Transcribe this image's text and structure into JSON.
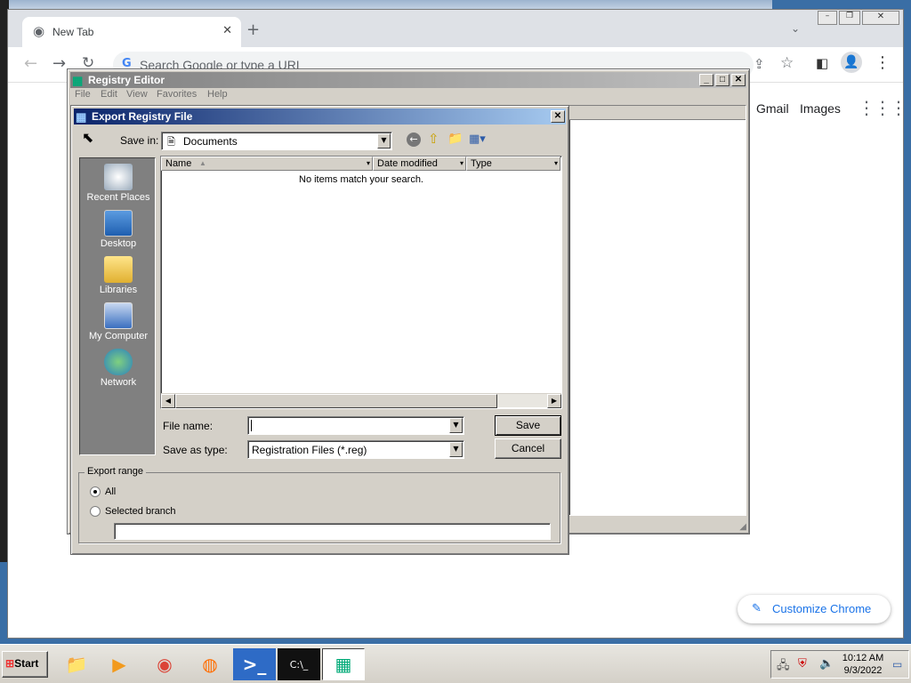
{
  "chrome": {
    "tab_title": "New Tab",
    "omnibox_placeholder": "Search Google or type a URL",
    "links": {
      "gmail": "Gmail",
      "images": "Images"
    },
    "customize_label": "Customize Chrome"
  },
  "regedit": {
    "title": "Registry Editor",
    "menu": [
      "File",
      "Edit",
      "View",
      "Favorites",
      "Help"
    ]
  },
  "dialog": {
    "title": "Export Registry File",
    "save_in_label": "Save in:",
    "save_in_value": "Documents",
    "places": [
      {
        "label": "Recent Places",
        "icon": "recent-places-icon"
      },
      {
        "label": "Desktop",
        "icon": "desktop-icon"
      },
      {
        "label": "Libraries",
        "icon": "libraries-icon"
      },
      {
        "label": "My Computer",
        "icon": "my-computer-icon"
      },
      {
        "label": "Network",
        "icon": "network-icon"
      }
    ],
    "columns": [
      "Name",
      "Date modified",
      "Type"
    ],
    "empty_message": "No items match your search.",
    "file_name_label": "File name:",
    "file_name_value": "",
    "save_as_type_label": "Save as type:",
    "save_as_type_value": "Registration Files (*.reg)",
    "save_button": "Save",
    "cancel_button": "Cancel",
    "export_range_label": "Export range",
    "radio_all": "All",
    "radio_selected_branch": "Selected branch",
    "selected_branch_value": ""
  },
  "taskbar": {
    "start_label": "Start",
    "time": "10:12 AM",
    "date": "9/3/2022"
  },
  "colors": {
    "desktop": "#3a6ea5",
    "active_title_start": "#0a246a",
    "active_title_end": "#a6caf0",
    "places_bar": "#808080",
    "chrome_accent": "#1a73e8"
  }
}
